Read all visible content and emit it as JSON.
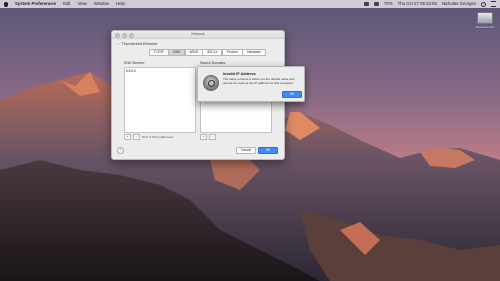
{
  "menubar": {
    "app_name": "System Preferences",
    "items": [
      "Edit",
      "View",
      "Window",
      "Help"
    ],
    "status": {
      "battery": "70%",
      "date_time": "Thu Oct 27  06:34:05",
      "user": "Nicholas Georges"
    }
  },
  "desktop": {
    "icon_label": "Macintosh HD"
  },
  "window": {
    "title": "Network",
    "interface_name": "Thunderbolt Ethernet",
    "tabs": [
      "TCP/IP",
      "DNS",
      "WINS",
      "802.1X",
      "Proxies",
      "Hardware"
    ],
    "active_tab": "DNS",
    "dns_servers_label": "DNS Servers:",
    "dns_servers": [
      "8.8.8.8"
    ],
    "search_domains_label": "Search Domains:",
    "ipv_note": "IPv4 or IPv6 addresses",
    "help": "?",
    "cancel_label": "Cancel",
    "ok_label": "OK"
  },
  "sheet": {
    "title": "Invalid IP Address",
    "message": "The value entered is either not the default value and cannot be used as the IP address for this computer.",
    "ok_label": "OK"
  },
  "colors": {
    "accent": "#3b8cf7",
    "menubar": "#ece4eb"
  }
}
